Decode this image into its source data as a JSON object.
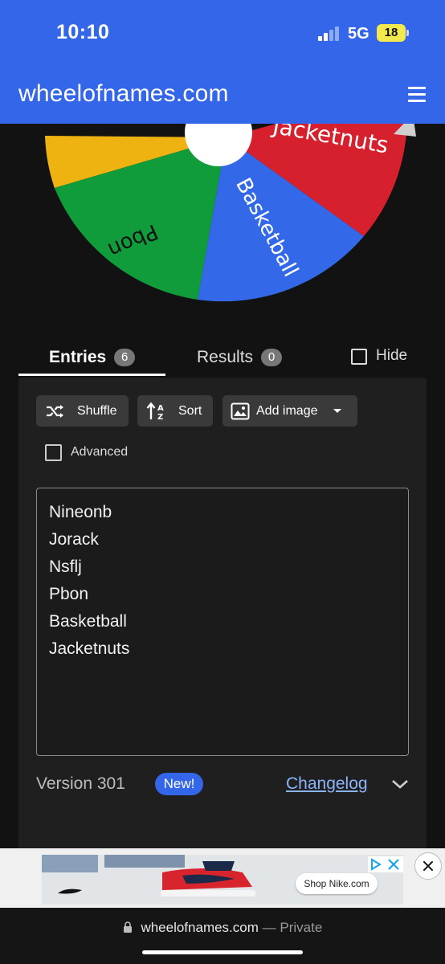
{
  "status_bar": {
    "time": "10:10",
    "network": "5G",
    "battery": "18"
  },
  "header": {
    "site_title": "wheelofnames.com"
  },
  "wheel": {
    "visible_labels": [
      "Jacketnuts",
      "Basketball",
      "Pbon"
    ],
    "colors": {
      "red": "#d6202e",
      "blue": "#3369e8",
      "green": "#109c3b",
      "yellow": "#eeb211",
      "center": "#ffffff"
    }
  },
  "tabs": {
    "entries": {
      "label": "Entries",
      "count": "6"
    },
    "results": {
      "label": "Results",
      "count": "0"
    },
    "hide_label": "Hide"
  },
  "toolbar": {
    "shuffle": "Shuffle",
    "sort": "Sort",
    "add_image": "Add image"
  },
  "advanced_label": "Advanced",
  "entries": [
    "Nineonb",
    "Jorack",
    "Nsflj",
    "Pbon",
    "Basketball",
    "Jacketnuts"
  ],
  "footer": {
    "version": "Version 301",
    "new_badge": "New!",
    "changelog": "Changelog"
  },
  "ad": {
    "shop_label": "Shop Nike.com"
  },
  "browser": {
    "url": "wheelofnames.com",
    "mode": "— Private"
  },
  "colors": {
    "brand_blue": "#3366e8",
    "background": "#121212",
    "panel": "#1f1f1f"
  }
}
